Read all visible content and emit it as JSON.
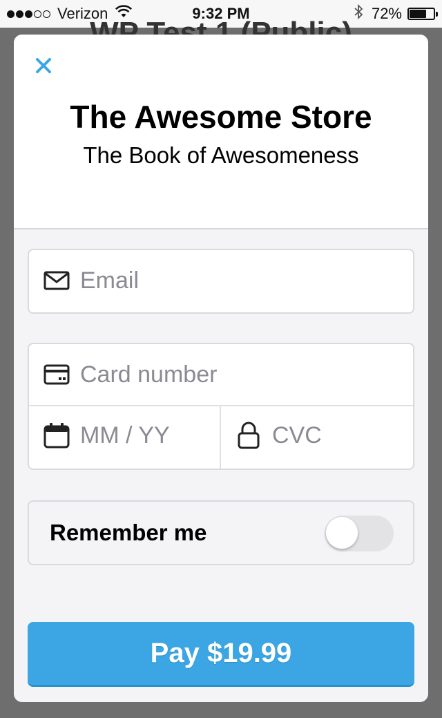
{
  "status_bar": {
    "carrier": "Verizon",
    "time": "9:32 PM",
    "battery_percent": "72%",
    "battery_level": 0.72,
    "signal_bars_filled": 3,
    "signal_bars_total": 5
  },
  "background_page": {
    "title": "WP Test 1 (Public)"
  },
  "checkout": {
    "store_name": "The Awesome Store",
    "product_name": "The Book of Awesomeness",
    "email": {
      "value": "",
      "placeholder": "Email",
      "icon": "envelope-icon"
    },
    "card_number": {
      "value": "",
      "placeholder": "Card number",
      "icon": "credit-card-icon"
    },
    "expiry": {
      "value": "",
      "placeholder": "MM / YY",
      "icon": "calendar-icon"
    },
    "cvc": {
      "value": "",
      "placeholder": "CVC",
      "icon": "lock-icon"
    },
    "remember_me": {
      "label": "Remember me",
      "enabled": false
    },
    "pay_button_label": "Pay $19.99"
  },
  "colors": {
    "accent": "#3ba6e3",
    "close_icon": "#3ba6e3",
    "modal_background": "#f4f4f6",
    "placeholder": "#8a8a93"
  }
}
